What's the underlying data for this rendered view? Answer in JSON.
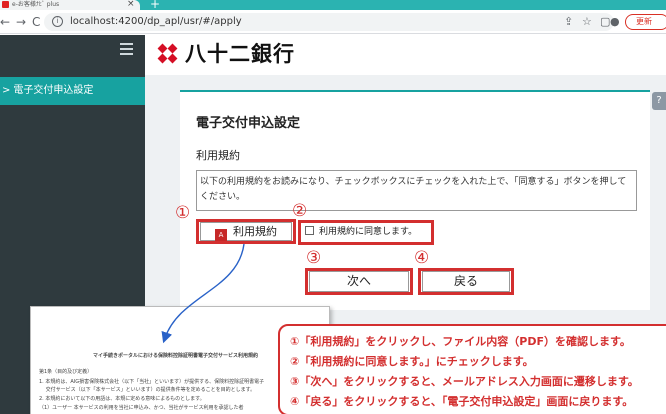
{
  "browser": {
    "tab_title": "e-お客様ﾅﾋﾞ plus",
    "url": "localhost:4200/dp_apl/usr/#/apply",
    "update_label": "更新"
  },
  "sidebar": {
    "items": [
      {
        "label": "電子交付申込設定"
      }
    ]
  },
  "header": {
    "logo_text": "八十二銀行"
  },
  "page": {
    "title": "電子交付申込設定",
    "section_title": "利用規約",
    "terms_text": "以下の利用規約をお読みになり、チェックボックスにチェックを入れた上で、「同意する」ボタンを押してください。",
    "terms_button_label": "利用規約",
    "agree_checkbox_label": "利用規約に同意します。",
    "next_button_label": "次へ",
    "back_button_label": "戻る"
  },
  "callouts": [
    "①",
    "②",
    "③",
    "④"
  ],
  "pdf_preview": {
    "title": "マイ手続きポータルにおける保険料控除証明書電子交付サービス利用規約",
    "lines": [
      "第1条（目的及び定義）",
      "1. 本規約は、AIG損害保険株式会社（以下「当社」といいます）が提供する、保険料控除証明書電子",
      "　 交付サービス（以下「本サービス」といいます）の提供条件等を定めることを目的とします。",
      "2. 本規約において以下の用語は、本規に定める意味によるものとします。",
      "（1）ユーザー 本サービスの利用を当社に申込み、かつ、当社がサービス利用を承認した者"
    ]
  },
  "legend": {
    "lines": [
      "①「利用規約」をクリックし、ファイル内容（PDF）を確認します。",
      "②「利用規約に同意します。」にチェックします。",
      "③「次へ」をクリックすると、メールアドレス入力画面に遷移します。",
      "④「戻る」をクリックすると、「電子交付申込設定」画面に戻ります。"
    ]
  },
  "colors": {
    "accent": "#17a2a0",
    "annotation_red": "#d32f2f",
    "brand_red": "#d50f25"
  }
}
